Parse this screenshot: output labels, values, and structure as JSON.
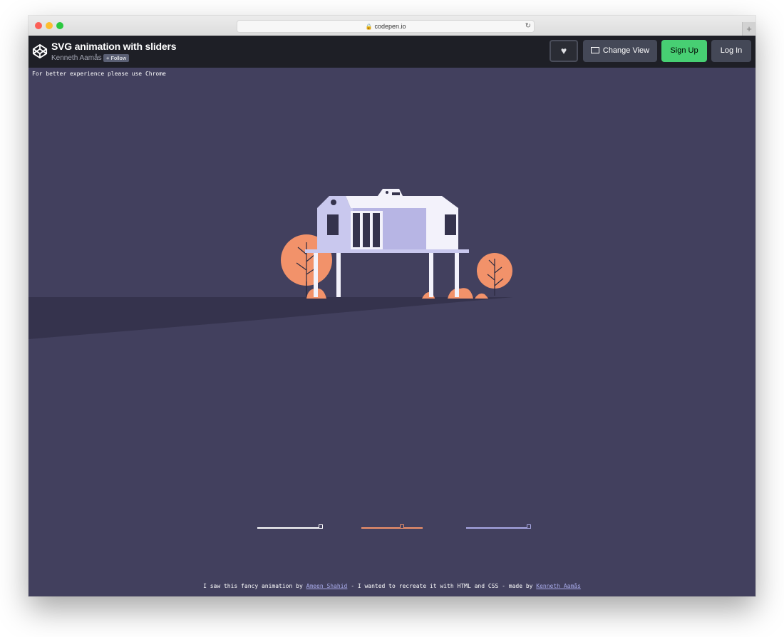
{
  "browser": {
    "url": "codepen.io"
  },
  "header": {
    "title": "SVG animation with sliders",
    "author": "Kenneth Aamås",
    "follow_label": "+ Follow",
    "change_view_label": "Change View",
    "signup_label": "Sign Up",
    "login_label": "Log In"
  },
  "stage": {
    "note": "For better experience please use Chrome",
    "background_color": "#42405e",
    "sliders": [
      {
        "name": "slider-white",
        "color": "#ffffff",
        "value": 1.0
      },
      {
        "name": "slider-orange",
        "color": "#f2926a",
        "value": 0.68
      },
      {
        "name": "slider-blue",
        "color": "#a9a9e5",
        "value": 1.0
      }
    ]
  },
  "footer": {
    "text_1": "I saw this fancy animation by ",
    "link_1": "Ameen Shahid",
    "text_2": " - I wanted to recreate it with HTML and CSS - made by ",
    "link_2": "Kenneth Aamås"
  },
  "colors": {
    "accent_green": "#47cf73",
    "tree_orange": "#f2926a",
    "house_lavender": "#b7b5e4",
    "house_white": "#f3f2fb"
  }
}
